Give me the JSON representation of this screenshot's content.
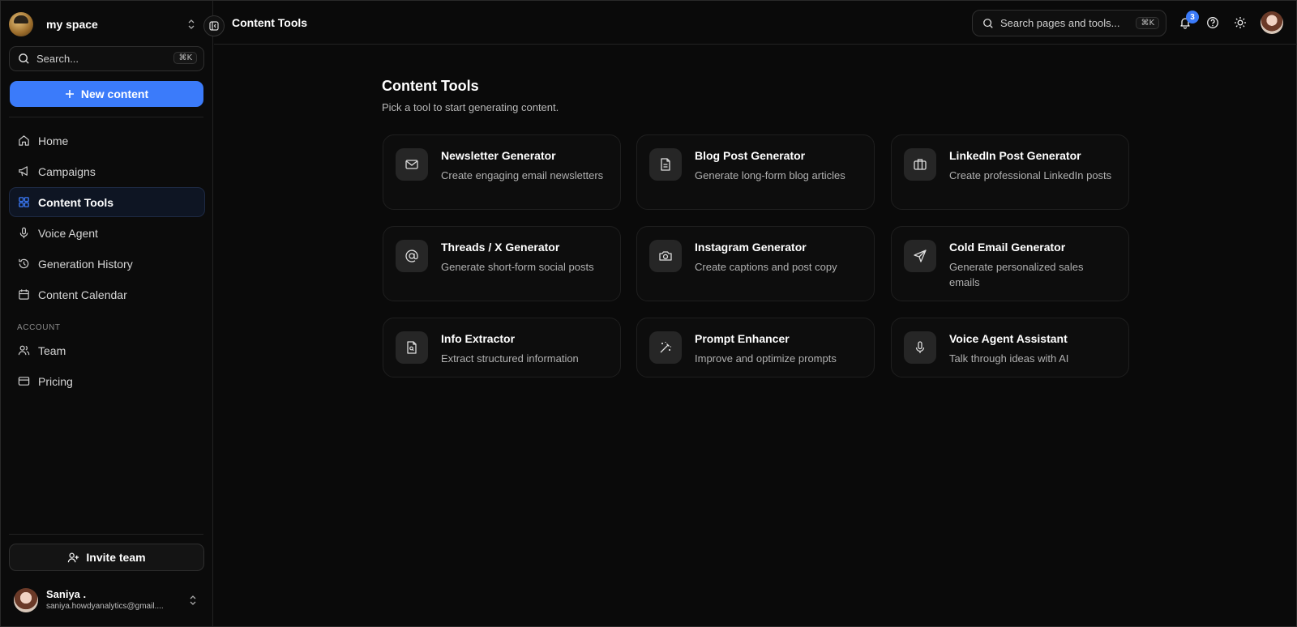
{
  "workspace": {
    "name": "my space"
  },
  "sidebar": {
    "search_placeholder": "Search...",
    "search_shortcut": "⌘K",
    "new_button": "New content",
    "nav": [
      {
        "label": "Home",
        "icon": "home-icon"
      },
      {
        "label": "Campaigns",
        "icon": "megaphone-icon"
      },
      {
        "label": "Content Tools",
        "icon": "grid-icon",
        "active": true
      },
      {
        "label": "Voice Agent",
        "icon": "mic-icon"
      },
      {
        "label": "Generation History",
        "icon": "history-icon"
      },
      {
        "label": "Content Calendar",
        "icon": "calendar-icon"
      }
    ],
    "account_section": "ACCOUNT",
    "account_nav": [
      {
        "label": "Team",
        "icon": "users-icon"
      },
      {
        "label": "Pricing",
        "icon": "credit-card-icon"
      }
    ],
    "invite_button": "Invite team"
  },
  "user": {
    "name": "Saniya .",
    "email": "saniya.howdyanalytics@gmail...."
  },
  "topbar": {
    "title": "Content Tools",
    "search_placeholder": "Search pages and tools...",
    "search_shortcut": "⌘K",
    "notification_count": "3"
  },
  "main": {
    "title": "Content Tools",
    "subtitle": "Pick a tool to start generating content.",
    "tools": [
      {
        "title": "Newsletter Generator",
        "desc": "Create engaging email newsletters",
        "icon": "mail-icon"
      },
      {
        "title": "Blog Post Generator",
        "desc": "Generate long-form blog articles",
        "icon": "document-icon"
      },
      {
        "title": "LinkedIn Post Generator",
        "desc": "Create professional LinkedIn posts",
        "icon": "briefcase-icon"
      },
      {
        "title": "Threads / X Generator",
        "desc": "Generate short-form social posts",
        "icon": "at-icon"
      },
      {
        "title": "Instagram Generator",
        "desc": "Create captions and post copy",
        "icon": "camera-icon"
      },
      {
        "title": "Cold Email Generator",
        "desc": "Generate personalized sales emails",
        "icon": "send-icon"
      },
      {
        "title": "Info Extractor",
        "desc": "Extract structured information",
        "icon": "file-search-icon"
      },
      {
        "title": "Prompt Enhancer",
        "desc": "Improve and optimize prompts",
        "icon": "magic-wand-icon"
      },
      {
        "title": "Voice Agent Assistant",
        "desc": "Talk through ideas with AI",
        "icon": "mic-icon"
      }
    ]
  },
  "colors": {
    "accent": "#3b7bfa",
    "background": "#0a0a0a",
    "card": "#0d0d0d"
  }
}
